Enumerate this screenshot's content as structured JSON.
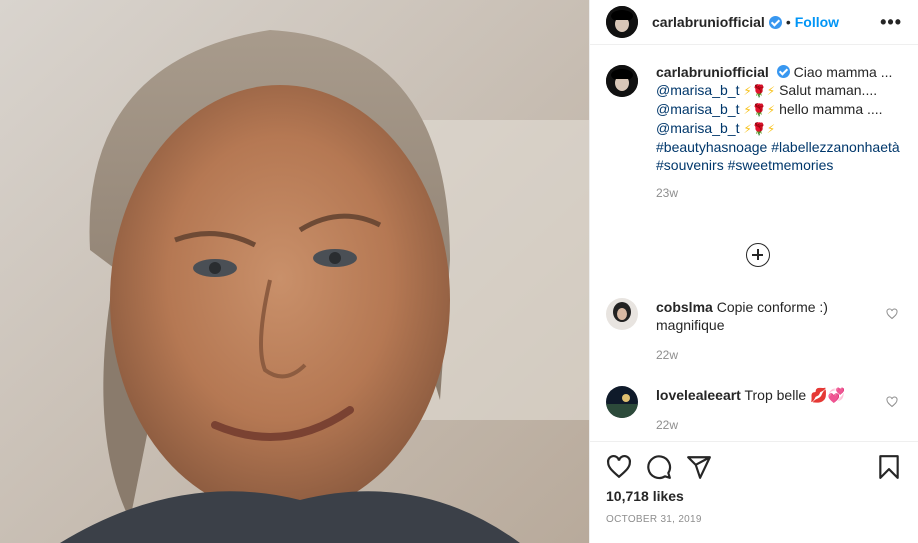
{
  "post": {
    "author": "carlabruniofficial",
    "follow_label": "Follow",
    "dot": "•",
    "more_label": "•••",
    "photo_icon": "portrait-photo"
  },
  "caption": {
    "username": "carlabruniofficial",
    "line1": "Ciao mamma ...",
    "mention": "@marisa_b_t",
    "emoji_bolt": "⚡",
    "emoji_rose": "🌹",
    "line2": "Salut maman....",
    "line3": "hello mamma ....",
    "hashtags1": "#beautyhasnoage",
    "hashtags2": "#labellezzanonhaetà",
    "hashtags3": "#souvenirs",
    "hashtags4": "#sweetmemories",
    "time": "23w"
  },
  "comments": [
    {
      "username": "cobslma",
      "text": "Copie conforme :) magnifique",
      "time": "22w"
    },
    {
      "username": "loveleale eart",
      "username_display": "loveleale eart",
      "text": "Trop belle",
      "emojis": "💋💞",
      "time": "22w"
    }
  ],
  "comment2": {
    "username": "loveleaIeeart"
  },
  "stats": {
    "likes": "10,718 likes",
    "date": "OCTOBER 31, 2019"
  },
  "icons": {
    "like": "heart-icon",
    "comment": "comment-icon",
    "share": "share-icon",
    "save": "bookmark-icon",
    "load_more": "plus-circle-icon"
  }
}
